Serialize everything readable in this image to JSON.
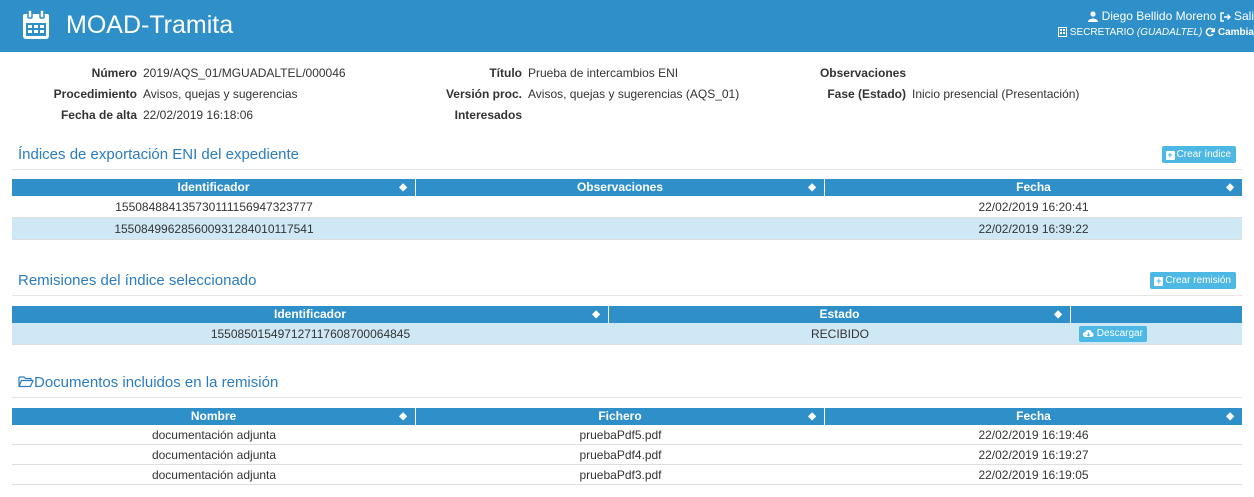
{
  "header": {
    "title": "MOAD-Tramita",
    "user_name": "Diego Bellido Moreno",
    "logout_label": "Sali",
    "role": "SECRETARIO",
    "org": "(GUADALTEL)",
    "change_label": "Cambia",
    "bar_color": "#2e8fc9"
  },
  "meta": {
    "col1": [
      {
        "label": "Número",
        "value": "2019/AQS_01/MGUADALTEL/000046"
      },
      {
        "label": "Procedimiento",
        "value": "Avisos, quejas y sugerencias"
      },
      {
        "label": "Fecha de alta",
        "value": "22/02/2019 16:18:06"
      }
    ],
    "col2": [
      {
        "label": "Título",
        "value": "Prueba de intercambios ENI"
      },
      {
        "label": "Versión proc.",
        "value": "Avisos, quejas y sugerencias (AQS_01)"
      },
      {
        "label": "Interesados",
        "value": ""
      }
    ],
    "col3": [
      {
        "label": "Observaciones",
        "value": ""
      },
      {
        "label": "Fase (Estado)",
        "value": "Inicio presencial (Presentación)"
      }
    ]
  },
  "indices": {
    "title": "Índices de exportación ENI del expediente",
    "button": "Crear índice",
    "headers": [
      "Identificador",
      "Observaciones",
      "Fecha"
    ],
    "rows": [
      [
        "15508488413573011115694732377​7",
        "",
        "22/02/2019 16:20:41"
      ],
      [
        "155084996285600931284010117541",
        "",
        "22/02/2019 16:39:22"
      ]
    ]
  },
  "remisiones": {
    "title": "Remisiones del índice seleccionado",
    "button": "Crear remisión",
    "headers": [
      "Identificador",
      "Estado",
      ""
    ],
    "rows": [
      [
        "155085015497127117608700064845",
        "RECIBIDO",
        "Descargar"
      ]
    ]
  },
  "documentos": {
    "title": "Documentos incluidos en la remisión",
    "headers": [
      "Nombre",
      "Fichero",
      "Fecha"
    ],
    "rows": [
      [
        "documentación adjunta",
        "pruebaPdf5.pdf",
        "22/02/2019 16:19:46"
      ],
      [
        "documentación adjunta",
        "pruebaPdf4.pdf",
        "22/02/2019 16:19:27"
      ],
      [
        "documentación adjunta",
        "pruebaPdf3.pdf",
        "22/02/2019 16:19:05"
      ]
    ]
  }
}
